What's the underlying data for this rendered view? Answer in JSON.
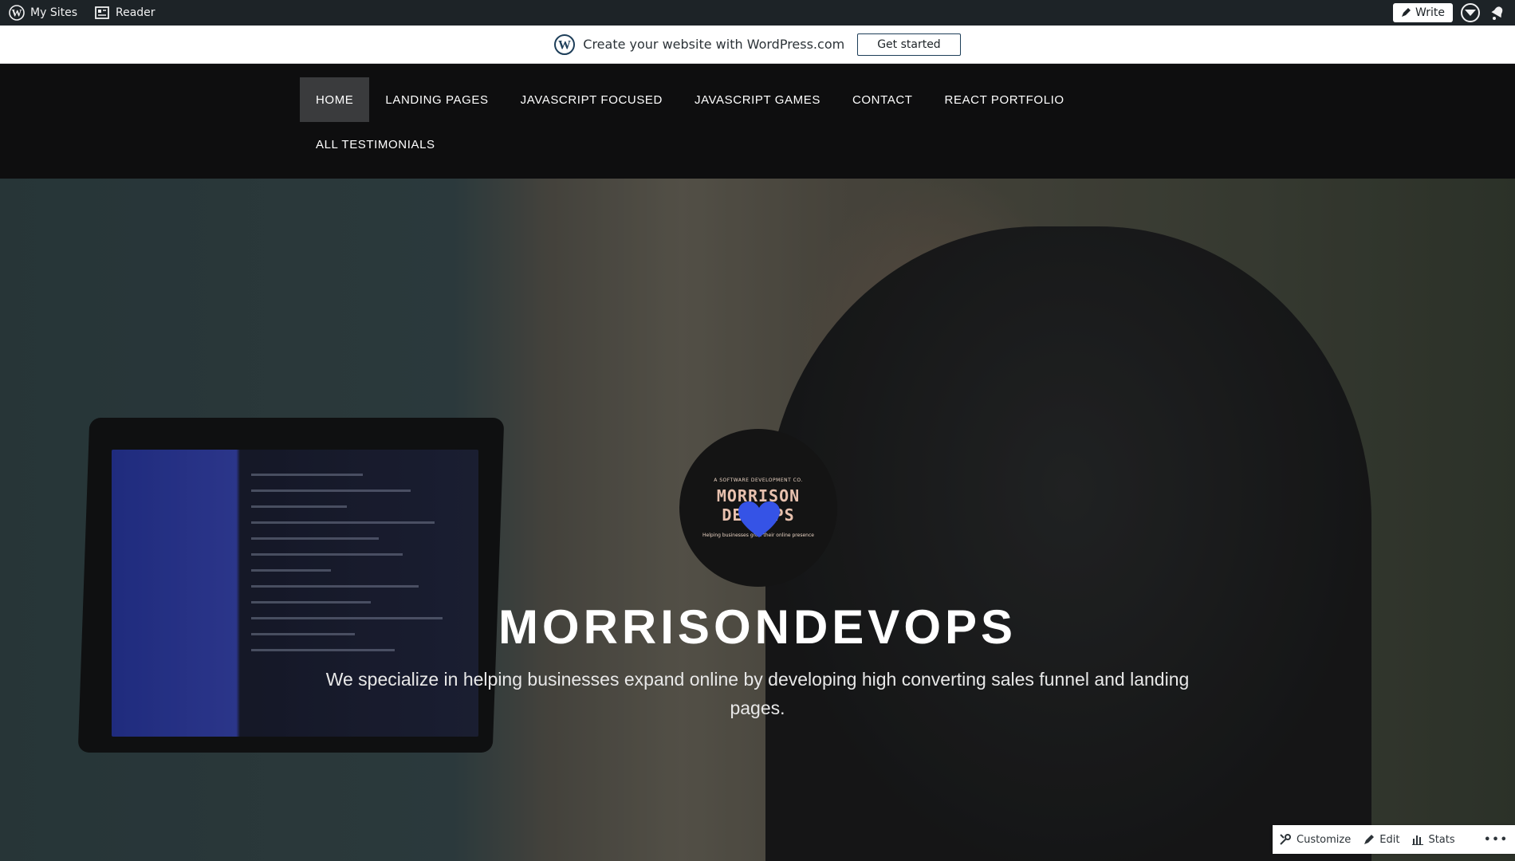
{
  "adminbar": {
    "my_sites": "My Sites",
    "reader": "Reader",
    "write": "Write",
    "icons": [
      "wordpress-logo-icon",
      "reader-icon",
      "pencil-icon",
      "avatar-icon",
      "notifications-icon"
    ]
  },
  "promo": {
    "text": "Create your website with WordPress.com",
    "button": "Get started"
  },
  "nav": {
    "items": [
      {
        "label": "HOME",
        "active": true
      },
      {
        "label": "LANDING PAGES"
      },
      {
        "label": "JAVASCRIPT FOCUSED"
      },
      {
        "label": "JAVASCRIPT GAMES"
      },
      {
        "label": "CONTACT"
      },
      {
        "label": "REACT PORTFOLIO"
      },
      {
        "label": "ALL TESTIMONIALS"
      }
    ]
  },
  "hero": {
    "logo": {
      "tagline": "A SOFTWARE DEVELOPMENT CO.",
      "line1": "MORRISON",
      "line2": "DEV OPS",
      "arc": "Helping businesses grow their online presence"
    },
    "title": "MORRISONDEVOPS",
    "subtitle": "We specialize in helping businesses expand online by developing high converting sales funnel and landing pages."
  },
  "actions": {
    "customize": "Customize",
    "edit": "Edit",
    "stats": "Stats",
    "more": "•••"
  },
  "colors": {
    "adminbar": "#1d2327",
    "nav": "#0e0e0f",
    "active_nav": "#3a3b3d",
    "heart": "#3553e6"
  }
}
